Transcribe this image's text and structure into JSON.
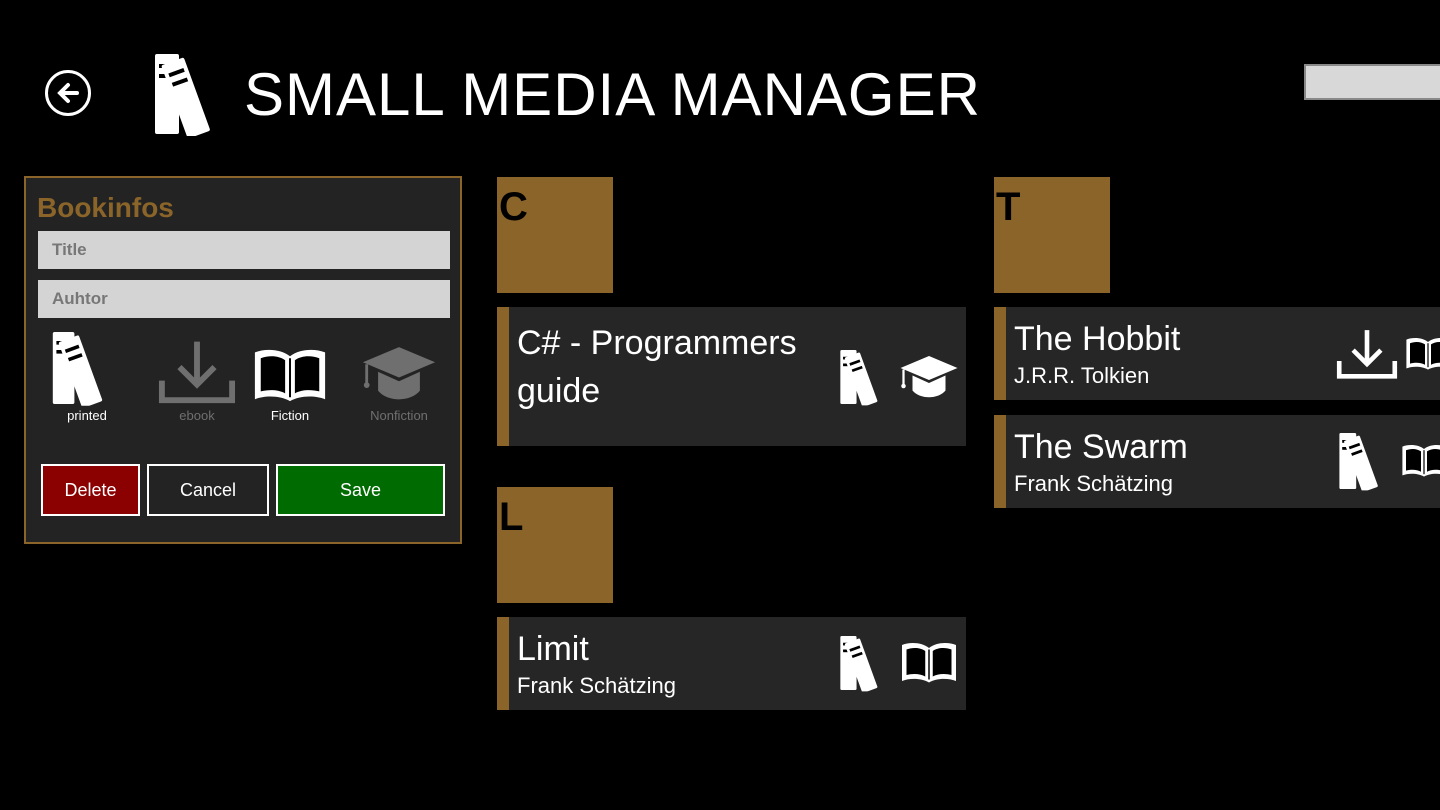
{
  "app": {
    "title": "SMALL MEDIA MANAGER"
  },
  "header": {
    "back_icon": "back-arrow-icon",
    "logo_icon": "books-icon",
    "search": {
      "value": "",
      "placeholder": ""
    }
  },
  "colors": {
    "accent": "#8a6428",
    "panel_bg": "#232323",
    "tile_bg": "#262626",
    "delete": "#8b0000",
    "save": "#006b00"
  },
  "editor": {
    "heading": "Bookinfos",
    "title_field": {
      "value": "",
      "placeholder": "Title"
    },
    "author_field": {
      "value": "",
      "placeholder": "Auhtor"
    },
    "options": [
      {
        "label": "printed",
        "icon": "books-icon",
        "selected": true
      },
      {
        "label": "ebook",
        "icon": "download-icon",
        "selected": false
      },
      {
        "label": "Fiction",
        "icon": "open-book-icon",
        "selected": true
      },
      {
        "label": "Nonfiction",
        "icon": "graduation-cap-icon",
        "selected": false
      }
    ],
    "buttons": {
      "delete": "Delete",
      "cancel": "Cancel",
      "save": "Save"
    }
  },
  "groups": [
    {
      "letter": "C",
      "items": [
        {
          "title": "C# - Programmers guide",
          "author": "",
          "icons": [
            "books-icon",
            "graduation-cap-icon"
          ]
        }
      ]
    },
    {
      "letter": "L",
      "items": [
        {
          "title": "Limit",
          "author": "Frank Schätzing",
          "icons": [
            "books-icon",
            "open-book-icon"
          ]
        }
      ]
    },
    {
      "letter": "T",
      "items": [
        {
          "title": "The Hobbit",
          "author": "J.R.R. Tolkien",
          "icons": [
            "download-icon",
            "open-book-icon"
          ]
        },
        {
          "title": "The Swarm",
          "author": "Frank Schätzing",
          "icons": [
            "books-icon",
            "open-book-icon"
          ]
        }
      ]
    }
  ]
}
